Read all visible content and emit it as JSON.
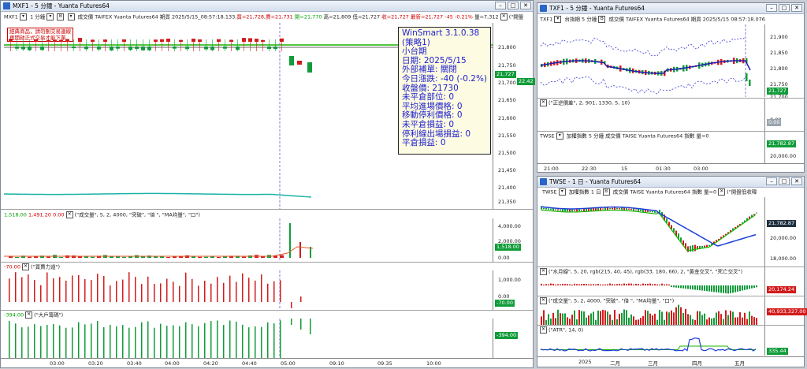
{
  "main": {
    "title": "MXF1 - 5 分鐘 - Yuanta Futures64",
    "toolbar": {
      "symbol": "MXF1",
      "period": "1 分鐘",
      "period_dd": "▾",
      "chart_type": "B",
      "volume": "成交價",
      "exchange": "TAIFEX",
      "source": "Yuanta Futures64",
      "quote_prefix": "期貨",
      "date": "2025/5/15",
      "time": "08:57:18.133",
      "bid": "買=21,728",
      "ask": "賣=21,731",
      "open": "開=21,770",
      "high": "高=21,809",
      "low": "低=21,727",
      "close": "收=21,727",
      "last": "最新=21,727",
      "chg": "-45",
      "pct": "-0.21%",
      "vol": "量=7,312",
      "note": "(\"開盤"
    },
    "notice": [
      "經典商品，請勿刪交易連線",
      "再開啟正式交易才能下單"
    ],
    "infobox": [
      "WinSmart 3.1.0.38",
      "(策略1)",
      "小台期",
      "日期: 2025/5/15",
      "外部補單: 關閉",
      "今日漲跌: -40 (-0.2%)",
      "收盤價: 21730",
      "未平倉部位: 0",
      "平均進場價格: 0",
      "移動停利價格: 0",
      "未平倉損益: 0",
      "停利線出場損益: 0",
      "平倉損益: 0"
    ],
    "price_ticks": [
      "21,800",
      "21,750",
      "21,700",
      "21,650",
      "21,600",
      "21,550",
      "21,500",
      "21,450",
      "21,400",
      "21,350"
    ],
    "price_tag_last": "21,727",
    "price_tag_2": "22.42",
    "vol_header": {
      "v1": "1,518.00",
      "v2": "1,491.20",
      "v3": "0.00",
      "formula": "(\"成交量\", 5, 2, 4000, \"突破\", \"倍 \", \"MA均量\", \"口\")"
    },
    "vol_ticks": [
      "4,000.00",
      "2,000.00",
      "0.00"
    ],
    "vol_tag": "1,518.00",
    "ind2_header": {
      "v": "-70.00",
      "name": "(\"買賣力道\")"
    },
    "ind2_ticks": [
      "1,000.00",
      "0.00"
    ],
    "ind2_tag": "-70.00",
    "ind3_header": {
      "v": "-394.00",
      "name": "(\"大戶籌碼\")"
    },
    "ind3_tag": "-394.00",
    "time_ticks": [
      "03:00",
      "03:20",
      "03:40",
      "04:00",
      "04:20",
      "04:40",
      "05:00",
      "09:10",
      "09:35",
      "10:00"
    ]
  },
  "tr": {
    "title": "TXF1 - 5 分鐘 - Yuanta Futures64",
    "toolbar": {
      "symbol": "TXF1",
      "name": "台指期",
      "period": "5 分鐘",
      "chart_type": "B",
      "volume": "成交價",
      "exchange": "TAIFEX",
      "source": "Yuanta Futures64",
      "prefix": "期貨",
      "date": "2025/5/15",
      "time": "08:57:18.076"
    },
    "price_ticks": [
      "21,900",
      "21,850",
      "21,800",
      "21,750",
      "21,700"
    ],
    "price_tag": "21,727",
    "ind_header": "(\"正逆價差\", 2, 901, 1330, 5, 10)",
    "ind_ticks": [
      "0.00"
    ],
    "ind_tag": "0.00",
    "twse_header": {
      "symbol": "TWSE",
      "name": "加權指數",
      "period": "5 分鐘",
      "volume": "成交價",
      "exchange": "TAISE",
      "source": "Yuanta Futures64",
      "kind": "指數",
      "vol": "量=0"
    },
    "twse_tag": "21,782.87",
    "twse_ticks": [
      "20,000.00"
    ],
    "time_ticks": [
      "21:00",
      "22:30",
      "15",
      "01:30",
      "03:00"
    ]
  },
  "br": {
    "title": "TWSE - 1 日 - Yuanta Futures64",
    "toolbar": {
      "symbol": "TWSE",
      "name": "加權指數",
      "period": "1 日",
      "chart_type": "B",
      "volume": "成交價",
      "exchange": "TAISE",
      "source": "Yuanta Futures64",
      "kind": "指數",
      "vol": "量=0",
      "note": "(\"開盤低收韓"
    },
    "price_ticks": [
      "20,000.00",
      "18,000.00"
    ],
    "price_tag": "21,782.87",
    "ind1_header": "(\"水月線\", 5, 20, rgb(215, 40, 45), rgb(33, 180, 66), 2, \"黃金交叉\", \"死亡交叉\")",
    "ind1_tag": "20,174.24",
    "ind2_header": "(\"成交量\", 5, 2, 4000, \"突破\", \"倍 \", \"MA均量\", \"口\")",
    "ind2_tag": "40,933,327.00",
    "ind3_header": "(\"ATR\", 14, 0)",
    "ind3_tag": "335.44",
    "time_ticks": [
      "2025",
      "二月",
      "三月",
      "四月",
      "五月"
    ]
  },
  "colors": {
    "up": "#d31b1b",
    "down": "#119c3a",
    "ma_blue": "#1c3fd6",
    "cyan": "#19b3a6",
    "info_text": "#2020d0"
  }
}
